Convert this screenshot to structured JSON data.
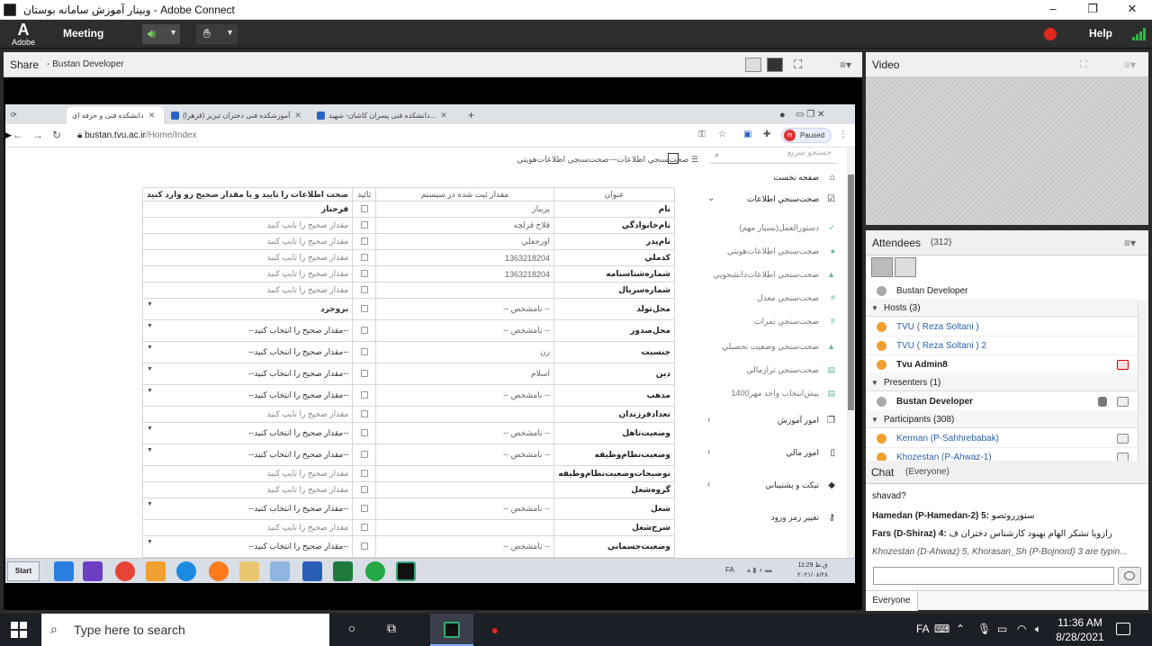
{
  "window": {
    "title": "وبینار آموزش سامانه بوستان - Adobe Connect",
    "controls": [
      "–",
      "❐",
      "✕"
    ]
  },
  "app_bar": {
    "logo_text": "Adobe",
    "logo_letter": "A",
    "meeting_menu": "Meeting",
    "help": "Help",
    "icons": [
      "speaker-icon",
      "raise-hand-icon",
      "record-icon",
      "signal-icon"
    ]
  },
  "share_pod": {
    "title": "Share",
    "subtitle": "- Bustan Developer"
  },
  "browser": {
    "tabs": [
      {
        "label": "دانشکده فنی و حرفه ای",
        "close": "✕",
        "active": true
      },
      {
        "label": "آموزشکده فنی دختران تبریز (قزهرا)",
        "close": "✕",
        "active": false
      },
      {
        "label": "دانشکده فنی پسران کاشان- شهید...",
        "close": "✕",
        "active": false
      }
    ],
    "new_tab": "+",
    "url_host": "bustan.tvu.ac.ir",
    "url_path": "/Home/Index",
    "profile_letter": "m",
    "profile_status": "Paused",
    "nav_back": "←",
    "nav_forward": "→",
    "nav_reload": "↻"
  },
  "page": {
    "breadcrumb": "صحت‌سنجي اطلاعات---صحت‌سنجي اطلاعات‌هويتي",
    "search_placeholder": "جستجو سريع",
    "sidebar": [
      {
        "label": "صفحه نخست",
        "icon": "home-icon",
        "chevron": ""
      },
      {
        "label": "صحت‌سنجي اطلاعات",
        "icon": "checkbox-icon",
        "chevron": "⌄"
      },
      {
        "label": "دستورالعمل(بسیار مهم)",
        "icon": "check-icon",
        "chevron": ""
      },
      {
        "label": "صحت‌سنجي اطلاعات‌هويتي",
        "icon": "user-icon",
        "chevron": ""
      },
      {
        "label": "صحت‌سنجي اطلاعات‌دانشجويي",
        "icon": "graduation-icon",
        "chevron": ""
      },
      {
        "label": "صحت‌سنجي معدل",
        "icon": "hash-icon",
        "chevron": ""
      },
      {
        "label": "صحت‌سنجي نمرات",
        "icon": "hash-icon",
        "chevron": ""
      },
      {
        "label": "صحت‌سنجي وضعيت تحصيلي",
        "icon": "graduation-icon",
        "chevron": ""
      },
      {
        "label": "صحت‌سنجي ترازمالي",
        "icon": "card-icon",
        "chevron": ""
      },
      {
        "label": "پیش‌انتخاب واحد مهر1400",
        "icon": "card-icon",
        "chevron": ""
      },
      {
        "label": "امور آموزش",
        "icon": "copy-icon",
        "chevron": "›"
      },
      {
        "label": "امور مالي",
        "icon": "document-icon",
        "chevron": "›"
      },
      {
        "label": "تيكت و پشتيباني",
        "icon": "tag-icon",
        "chevron": "›"
      },
      {
        "label": "تغيير رمز ورود",
        "icon": "key-icon",
        "chevron": ""
      }
    ],
    "table": {
      "headers": [
        "عنوان",
        "مقدار ثبت شده در سيستم",
        "تائيد",
        "صحت اطلاعات را تاييد و يا مقدار صحيح رو وارد كنيد"
      ],
      "rows": [
        {
          "field": "نام",
          "value": "پريناز",
          "input": "فرحناز",
          "kind": "filled"
        },
        {
          "field": "نام‌خانوادگي",
          "value": "قلاح قزلچه",
          "input": "مقدار صحيح را تايپ كنيد",
          "kind": "text"
        },
        {
          "field": "نام‌پدر",
          "value": "اورجعلي",
          "input": "مقدار صحيح را تايپ كنيد",
          "kind": "text"
        },
        {
          "field": "كدملي",
          "value": "1363218204",
          "input": "مقدار صحيح را تايپ كنيد",
          "kind": "text"
        },
        {
          "field": "شماره‌شناسنامه",
          "value": "1363218204",
          "input": "مقدار صحيح را تايپ كنيد",
          "kind": "text"
        },
        {
          "field": "شماره‌سريال",
          "value": "",
          "input": "مقدار صحيح را تايپ كنيد",
          "kind": "text"
        },
        {
          "field": "محل‌تولد",
          "value": "-- نامشخص --",
          "input": "بروجرد",
          "kind": "select-filled"
        },
        {
          "field": "محل‌صدور",
          "value": "-- نامشخص --",
          "input": "--مقدار صحيح را انتخاب كنيد--",
          "kind": "select"
        },
        {
          "field": "جنسيت",
          "value": "زن",
          "input": "--مقدار صحيح را انتخاب كنيد--",
          "kind": "select"
        },
        {
          "field": "دين",
          "value": "اسلام",
          "input": "--مقدار صحيح را انتخاب كنيد--",
          "kind": "select"
        },
        {
          "field": "مذهب",
          "value": "-- نامشخص --",
          "input": "--مقدار صحيح را انتخاب كنيد--",
          "kind": "select"
        },
        {
          "field": "تعدادفرزندان",
          "value": "",
          "input": "مقدار صحيح را تايپ كنيد",
          "kind": "text"
        },
        {
          "field": "وضعيت‌تاهل",
          "value": "-- نامشخص --",
          "input": "--مقدار صحيح را انتخاب كنيد--",
          "kind": "select"
        },
        {
          "field": "وضعيت‌نظام‌وظيفه",
          "value": "-- نامشخص --",
          "input": "--مقدار صحيح را انتخاب كنيد--",
          "kind": "select"
        },
        {
          "field": "توضيحات‌وضعيت‌نظام‌وظيفه",
          "value": "",
          "input": "مقدار صحيح را تايپ كنيد",
          "kind": "text"
        },
        {
          "field": "گروه‌شغل",
          "value": "",
          "input": "مقدار صحيح را تايپ كنيد",
          "kind": "text"
        },
        {
          "field": "شغل",
          "value": "-- نامشخص --",
          "input": "--مقدار صحيح را انتخاب كنيد--",
          "kind": "select"
        },
        {
          "field": "شرح‌شغل",
          "value": "",
          "input": "مقدار صحيح را تايپ كنيد",
          "kind": "text"
        },
        {
          "field": "وضعيت‌جسماني",
          "value": "-- نامشخص --",
          "input": "--مقدار صحيح را انتخاب كنيد--",
          "kind": "select"
        }
      ]
    }
  },
  "remote_taskbar": {
    "start": "Start",
    "lang": "FA",
    "time": "11:29 ق.ظ",
    "date": "۲۰۲۱/۰۸/۲۸"
  },
  "video_pod": {
    "title": "Video"
  },
  "attendees_pod": {
    "title": "Attendees",
    "count": "(312)",
    "current_user": "Bustan Developer",
    "groups": [
      {
        "label": "Hosts (3)",
        "members": [
          {
            "name": "TVU ( Reza Soltani )",
            "style": "link"
          },
          {
            "name": "TVU ( Reza Soltani ) 2",
            "style": "link"
          },
          {
            "name": "Tvu Admin8",
            "style": "bold",
            "cam": "red"
          }
        ]
      },
      {
        "label": "Presenters (1)",
        "members": [
          {
            "name": "Bustan Developer",
            "style": "bold",
            "cam": "on"
          }
        ]
      },
      {
        "label": "Participants (308)",
        "members": [
          {
            "name": "Kerman (P-Sahhrebabak)",
            "style": "link",
            "cam": "on"
          },
          {
            "name": "Khozestan (P-Ahwaz-1)",
            "style": "link",
            "cam": "on"
          }
        ]
      }
    ]
  },
  "chat_pod": {
    "title": "Chat",
    "scope": "(Everyone)",
    "messages": [
      {
        "sender": "",
        "text": "shavad?"
      },
      {
        "sender": "Hamedan (P-Hamedan-2) 5:",
        "text": "ستورروتصو"
      },
      {
        "sender": "Fars (D-Shiraz) 4:",
        "text": "رازويا تشکر الهام بهبود کارشناس دختران ف"
      }
    ],
    "typing": "Khozestan (D-Ahwaz) 5, Khorasan_Sh (P-Bojnord) 3 are typin...",
    "recipient": "Everyone"
  },
  "win_taskbar": {
    "search_placeholder": "Type here to search",
    "lang": "FA",
    "time": "11:36 AM",
    "date": "8/28/2021"
  }
}
